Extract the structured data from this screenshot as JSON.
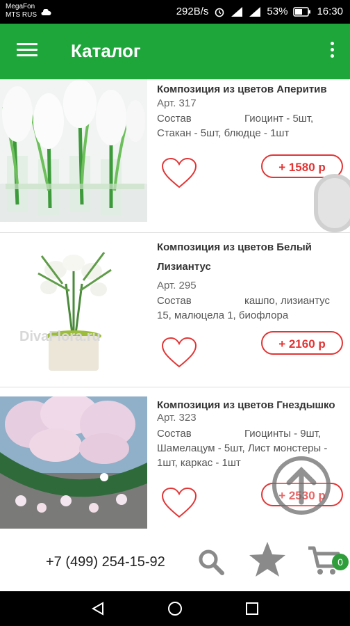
{
  "status_bar": {
    "carrier1": "MegaFon",
    "carrier2": "MTS RUS",
    "speed": "292B/s",
    "battery": "53%",
    "time": "16:30"
  },
  "app_bar": {
    "title": "Каталог"
  },
  "products": [
    {
      "name": "Композиция из цветов Аперитив",
      "article": "Арт. 317",
      "composition_label": "Состав",
      "composition_first": "Гиоцинт - 5шт,",
      "composition_rest": "Стакан - 5шт, блюдце - 1шт",
      "price": "+ 1580 р"
    },
    {
      "name": "Композиция из цветов Белый Лизиантус",
      "article": "Арт. 295",
      "composition_label": "Состав",
      "composition_first": "кашпо, лизиантус",
      "composition_rest": "15, малюцела 1, биофлора",
      "watermark": "DivaFlora.ru",
      "price": "+ 2160 р"
    },
    {
      "name": "Композиция из цветов Гнездышко",
      "article": "Арт. 323",
      "composition_label": "Состав",
      "composition_first": "Гиоцинты - 9шт,",
      "composition_rest": "Шамелацум - 5шт, Лист монстеры - 1шт, каркас - 1шт",
      "price": "+ 2530 р"
    }
  ],
  "bottom_bar": {
    "phone": "+7 (499) 254-15-92",
    "cart_count": "0"
  },
  "colors": {
    "primary": "#1fa63a",
    "accent_red": "#e23535",
    "icon_gray": "#8a8a8a"
  }
}
